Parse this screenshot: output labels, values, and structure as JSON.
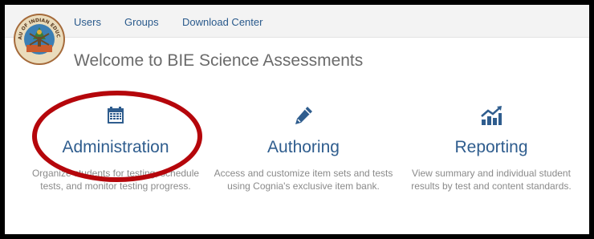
{
  "nav": {
    "items": [
      "Users",
      "Groups",
      "Download Center"
    ]
  },
  "logo": {
    "text": "BUREAU OF INDIAN EDUCATION"
  },
  "welcome": "Welcome to BIE Science Assessments",
  "tiles": [
    {
      "icon": "calendar-icon",
      "title": "Administration",
      "desc": "Organize students for testing, schedule tests, and monitor testing progress."
    },
    {
      "icon": "pencil-icon",
      "title": "Authoring",
      "desc": "Access and customize item sets and tests using Cognia's exclusive item bank."
    },
    {
      "icon": "chart-icon",
      "title": "Reporting",
      "desc": "View summary and individual student results by test and content standards."
    }
  ],
  "colors": {
    "link": "#2a5a8c",
    "tile_title": "#2f5d8e",
    "highlight_oval": "#b5060b"
  }
}
